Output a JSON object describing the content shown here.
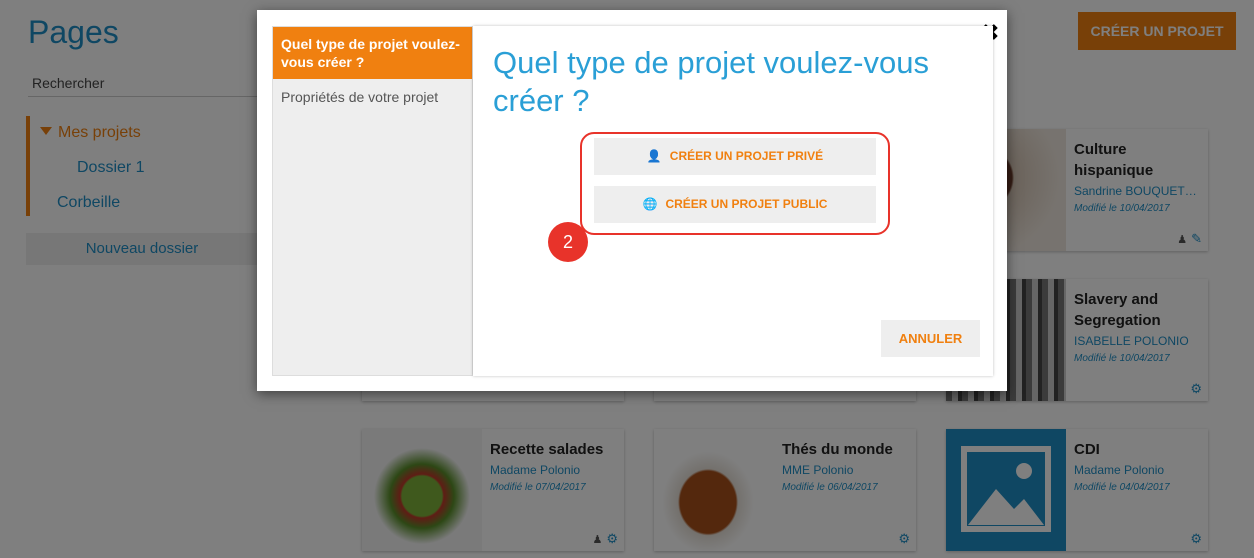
{
  "page": {
    "title": "Pages",
    "search_placeholder": "Rechercher",
    "create_project_label": "CRÉER UN PROJET",
    "new_folder_label": "Nouveau dossier"
  },
  "tree": {
    "my_projects": "Mes projets",
    "folder1": "Dossier 1",
    "trash": "Corbeille"
  },
  "cards": [
    {
      "title": "Culture hispanique",
      "author": "Sandrine BOUQUETY (...",
      "modified": "Modifié le 10/04/2017"
    },
    {
      "title": "Slavery and Segregation",
      "author": "ISABELLE POLONIO",
      "modified": "Modifié le 10/04/2017"
    },
    {
      "title": "Recette salades",
      "author": "Madame Polonio",
      "modified": "Modifié le 07/04/2017"
    },
    {
      "title": "Thés du monde",
      "author": "MME Polonio",
      "modified": "Modifié le 06/04/2017"
    },
    {
      "title": "CDI",
      "author": "Madame Polonio",
      "modified": "Modifié le 04/04/2017"
    }
  ],
  "modal": {
    "steps": [
      "Quel type de projet voulez-vous créer ?",
      "Propriétés de votre projet"
    ],
    "heading": "Quel type de projet voulez-vous créer ?",
    "private_label": "CRÉER UN PROJET PRIVÉ",
    "public_label": "CRÉER UN PROJET PUBLIC",
    "badge": "2",
    "cancel_label": "ANNULER",
    "close_glyph": "✖"
  },
  "colors": {
    "accent": "#f08010",
    "link": "#1f8fc7",
    "highlight": "#e8332a"
  }
}
